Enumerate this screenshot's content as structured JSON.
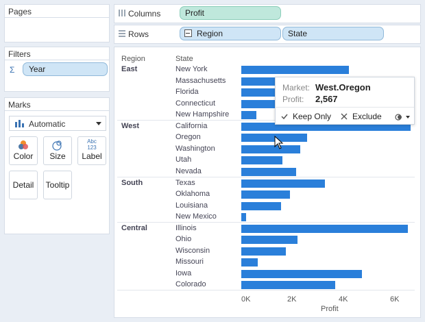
{
  "pages_panel": {
    "title": "Pages"
  },
  "filters_panel": {
    "title": "Filters",
    "filter_pill": "Year"
  },
  "marks_panel": {
    "title": "Marks",
    "mark_type": "Automatic",
    "buttons": {
      "color": "Color",
      "size": "Size",
      "label": "Label",
      "label_icon_top": "Abc",
      "label_icon_bottom": "123",
      "detail": "Detail",
      "tooltip": "Tooltip"
    }
  },
  "columns_shelf": {
    "name": "Columns",
    "pill": "Profit"
  },
  "rows_shelf": {
    "name": "Rows",
    "pills": [
      "Region",
      "State"
    ]
  },
  "chart": {
    "headers": {
      "region": "Region",
      "state": "State"
    },
    "x_label": "Profit",
    "x_ticks": [
      "0K",
      "2K",
      "4K",
      "6K"
    ],
    "bar_color": "#2a7fda",
    "regions": [
      "East",
      "West",
      "South",
      "Central"
    ],
    "states": [
      "New York",
      "Massachusetts",
      "Florida",
      "Connecticut",
      "New Hampshire",
      "California",
      "Oregon",
      "Washington",
      "Utah",
      "Nevada",
      "Texas",
      "Oklahoma",
      "Louisiana",
      "New Mexico",
      "Illinois",
      "Ohio",
      "Wisconsin",
      "Missouri",
      "Iowa",
      "Colorado"
    ]
  },
  "chart_data": {
    "type": "bar",
    "orientation": "horizontal",
    "xlabel": "Profit",
    "xlim": [
      0,
      6600
    ],
    "groups": [
      {
        "region": "East",
        "states": [
          "New York",
          "Massachusetts",
          "Florida",
          "Connecticut",
          "New Hampshire"
        ],
        "values": [
          4200,
          1700,
          1600,
          1500,
          600
        ]
      },
      {
        "region": "West",
        "states": [
          "California",
          "Oregon",
          "Washington",
          "Utah",
          "Nevada"
        ],
        "values": [
          6600,
          2567,
          2300,
          1600,
          2150
        ]
      },
      {
        "region": "South",
        "states": [
          "Texas",
          "Oklahoma",
          "Louisiana",
          "New Mexico"
        ],
        "values": [
          3250,
          1900,
          1550,
          200
        ]
      },
      {
        "region": "Central",
        "states": [
          "Illinois",
          "Ohio",
          "Wisconsin",
          "Missouri",
          "Iowa",
          "Colorado"
        ],
        "values": [
          6500,
          2200,
          1750,
          650,
          4700,
          3650
        ]
      }
    ]
  },
  "tooltip": {
    "market_label": "Market:",
    "market_value": "West.Oregon",
    "profit_label": "Profit:",
    "profit_value": "2,567",
    "keep_only": "Keep Only",
    "exclude": "Exclude"
  }
}
